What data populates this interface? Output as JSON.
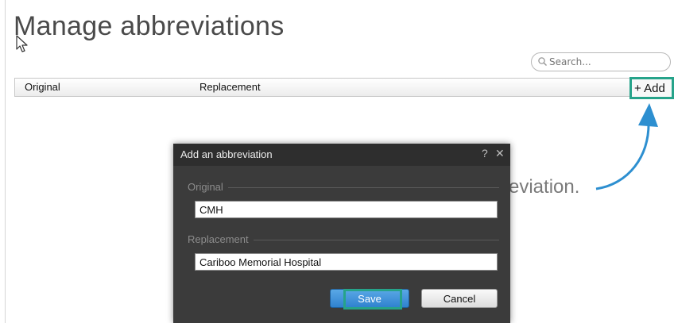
{
  "page": {
    "title": "Manage abbreviations"
  },
  "search": {
    "placeholder": "Search...",
    "icon": "search-icon"
  },
  "table": {
    "columns": [
      "Original",
      "Replacement"
    ],
    "add_label": "+ Add",
    "empty_hint": "eviation."
  },
  "dialog": {
    "title": "Add an abbreviation",
    "help_label": "?",
    "close_label": "✕",
    "original": {
      "label": "Original",
      "value": "CMH"
    },
    "replacement": {
      "label": "Replacement",
      "value": "Cariboo Memorial Hospital"
    },
    "save_label": "Save",
    "cancel_label": "Cancel"
  },
  "colors": {
    "highlight": "#26a38a",
    "arrow": "#2d8fd0",
    "dialog_bg": "#3b3b3b",
    "primary_button": "#2f82cf"
  }
}
